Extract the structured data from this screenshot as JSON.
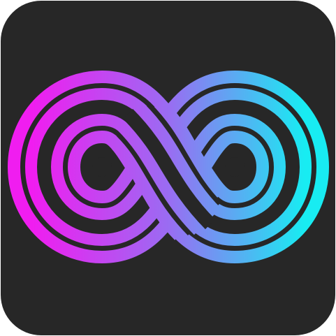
{
  "app_icon": {
    "icon": "infinity-icon",
    "colors": {
      "tile_background": "#272727",
      "gradient_magenta": "#f01df0",
      "gradient_purple": "#9a6cf2",
      "gradient_cyan": "#18ecf2",
      "gradient_dark_magenta": "#a31fa8"
    }
  }
}
